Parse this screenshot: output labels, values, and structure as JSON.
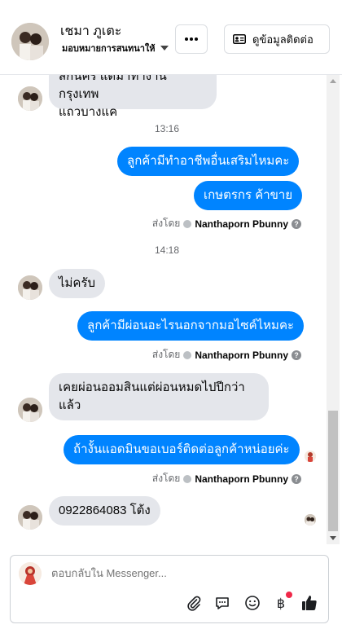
{
  "header": {
    "contact_name": "เชมา ภูเตะ",
    "assign_label": "มอบหมายการสนทนาให้",
    "more_icon": "more-dots-icon",
    "contact_info_label": "ดูข้อมูลติดต่อ",
    "contact_info_icon": "id-card-icon"
  },
  "thread": {
    "messages": [
      {
        "dir": "in",
        "text_line1": "สกนคร แดมาทำงานกรุงเทพ",
        "text_line2": "แถวบางแค"
      },
      {
        "type": "timestamp",
        "text": "13:16"
      },
      {
        "dir": "out",
        "text": "ลูกค้ามีทำอาชีพอื่นเสริมไหมคะ"
      },
      {
        "dir": "out",
        "text": "เกษตรกร ค้าขาย"
      },
      {
        "type": "sent_by",
        "prefix": "ส่งโดย",
        "name": "Nanthaporn Pbunny"
      },
      {
        "type": "timestamp",
        "text": "14:18"
      },
      {
        "dir": "in",
        "text": "ไม่ครับ"
      },
      {
        "dir": "out",
        "text": "ลูกค้ามีผ่อนอะไรนอกจากมอไซค์ไหมคะ"
      },
      {
        "type": "sent_by",
        "prefix": "ส่งโดย",
        "name": "Nanthaporn Pbunny"
      },
      {
        "dir": "in",
        "text_line1": "เคยผ่อนออมสินแต่ผ่อนหมดไปปีกว่า",
        "text_line2": "แล้ว"
      },
      {
        "dir": "out",
        "text": "ถ้างั้นแอดมินขอเบอร์ติดต่อลูกค้าหน่อยค่ะ"
      },
      {
        "type": "sent_by",
        "prefix": "ส่งโดย",
        "name": "Nanthaporn Pbunny"
      },
      {
        "dir": "in",
        "text": "0922864083 โต้ง"
      }
    ]
  },
  "composer": {
    "placeholder": "ตอบกลับใน Messenger...",
    "tools": [
      "paperclip-icon",
      "chat-bubble-icon",
      "smiley-icon",
      "baht-payment-icon",
      "thumbs-up-icon"
    ]
  },
  "colors": {
    "outgoing_bubble": "#0084ff",
    "incoming_bubble": "#e4e6eb",
    "notification_dot": "#f02849"
  }
}
